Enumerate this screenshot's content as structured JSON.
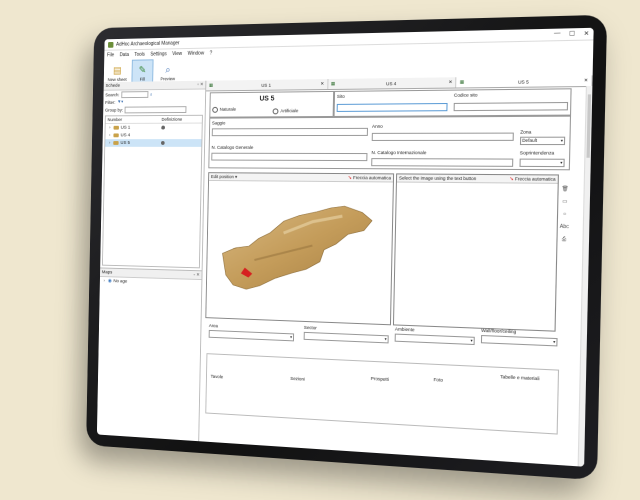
{
  "window": {
    "title": "AdHoc Archaeological Manager",
    "controls": [
      "—",
      "☐",
      "✕"
    ]
  },
  "menu": [
    "File",
    "Data",
    "Tools",
    "Settings",
    "View",
    "Window",
    "?"
  ],
  "toolbar": [
    {
      "label": "New sheet",
      "icon": "new-sheet-icon"
    },
    {
      "label": "Fill",
      "icon": "pencil-icon",
      "active": true
    },
    {
      "label": "Preview",
      "icon": "preview-icon"
    }
  ],
  "left_panel": {
    "title": "Schede",
    "search_label": "Search:",
    "filter_label": "Filter:",
    "group_label": "Group by:",
    "columns": [
      "Number",
      "Definizione"
    ],
    "items": [
      {
        "label": "US 1",
        "selected": false
      },
      {
        "label": "US 4",
        "selected": false
      },
      {
        "label": "US 5",
        "selected": true
      }
    ],
    "maps_title": "Maps",
    "maps_item": "No age"
  },
  "tabs": [
    "US 1",
    "US 4",
    "US 5"
  ],
  "form": {
    "record_title": "US 5",
    "radio_natural": "Naturale",
    "radio_artificial": "Artificiale",
    "sito": "Sito",
    "codice_sito": "Codice sito",
    "saggio": "Saggio",
    "anno": "Anno",
    "zona": "Zona",
    "zona_value": "Default",
    "cat_generale": "N. Catalogo Generale",
    "cat_internazionale": "N. Catalogo Internazionale",
    "soprintendenza": "Soprintendenza",
    "edit_position": "Edit position",
    "auto_scale": "Freccia automatica",
    "select_image": "Select the image using the text button",
    "area": "Area",
    "sector": "Sector",
    "ambiente": "Ambiente",
    "wall_layer": "Wall/floor/ceiling",
    "tavole": "Tavole",
    "sezioni": "Sezioni",
    "prospetti": "Prospetti",
    "foto": "Foto",
    "tabelle": "Tabelle e materiali",
    "side_abc": "Abc"
  },
  "colors": {
    "selection": "#cce4f7",
    "accent_blue": "#5b9bd5",
    "arrow_red": "#d22222",
    "artifact": "#c9a064"
  }
}
